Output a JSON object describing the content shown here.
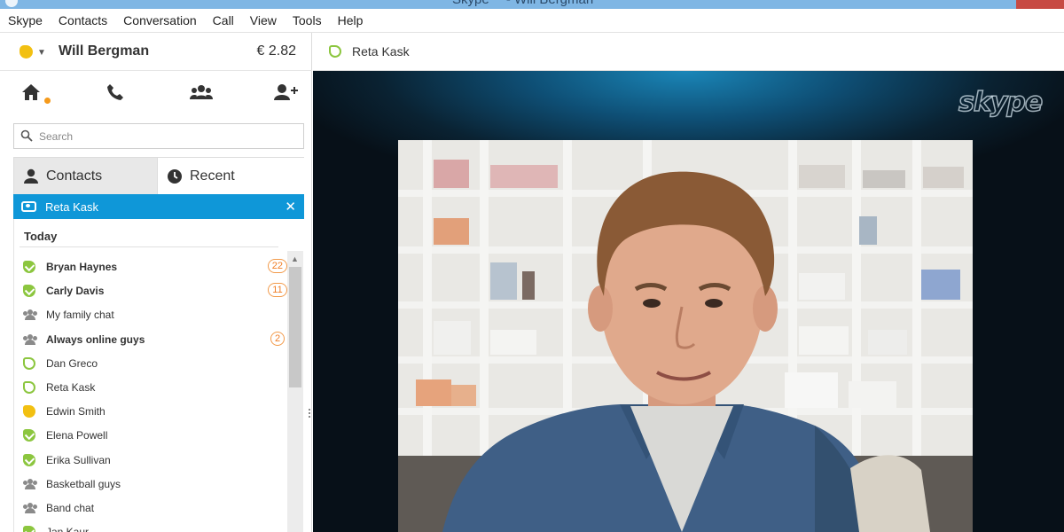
{
  "window": {
    "title": "Skype™ - Will Bergman"
  },
  "menu": [
    "Skype",
    "Contacts",
    "Conversation",
    "Call",
    "View",
    "Tools",
    "Help"
  ],
  "user": {
    "name": "Will Bergman",
    "credit": "€ 2.82",
    "status_color": "#f2c012"
  },
  "nav": {
    "icons": [
      "home-icon",
      "phone-icon",
      "group-icon",
      "add-contact-icon"
    ],
    "notification_color": "#f59a1b"
  },
  "search": {
    "placeholder": "Search"
  },
  "tabs": {
    "contacts": "Contacts",
    "recent": "Recent"
  },
  "active_call": {
    "name": "Reta Kask",
    "color": "#0f97d8"
  },
  "recent": {
    "section": "Today",
    "items": [
      {
        "name": "Bryan Haynes",
        "status": "online",
        "bold": true,
        "badge": "22"
      },
      {
        "name": "Carly Davis",
        "status": "online",
        "bold": true,
        "badge": "11"
      },
      {
        "name": "My family chat",
        "status": "group",
        "bold": false,
        "badge": ""
      },
      {
        "name": "Always online guys",
        "status": "group",
        "bold": true,
        "badge": "2"
      },
      {
        "name": "Dan Greco",
        "status": "offline",
        "bold": false,
        "badge": ""
      },
      {
        "name": "Reta Kask",
        "status": "offline",
        "bold": false,
        "badge": ""
      },
      {
        "name": "Edwin Smith",
        "status": "away",
        "bold": false,
        "badge": ""
      },
      {
        "name": "Elena Powell",
        "status": "online",
        "bold": false,
        "badge": ""
      },
      {
        "name": "Erika Sullivan",
        "status": "online",
        "bold": false,
        "badge": ""
      },
      {
        "name": "Basketball guys",
        "status": "group",
        "bold": false,
        "badge": ""
      },
      {
        "name": "Band chat",
        "status": "group",
        "bold": false,
        "badge": ""
      },
      {
        "name": "Jan Kaur",
        "status": "online",
        "bold": false,
        "badge": ""
      }
    ]
  },
  "conversation": {
    "name": "Reta Kask"
  },
  "video": {
    "watermark": "skype"
  }
}
